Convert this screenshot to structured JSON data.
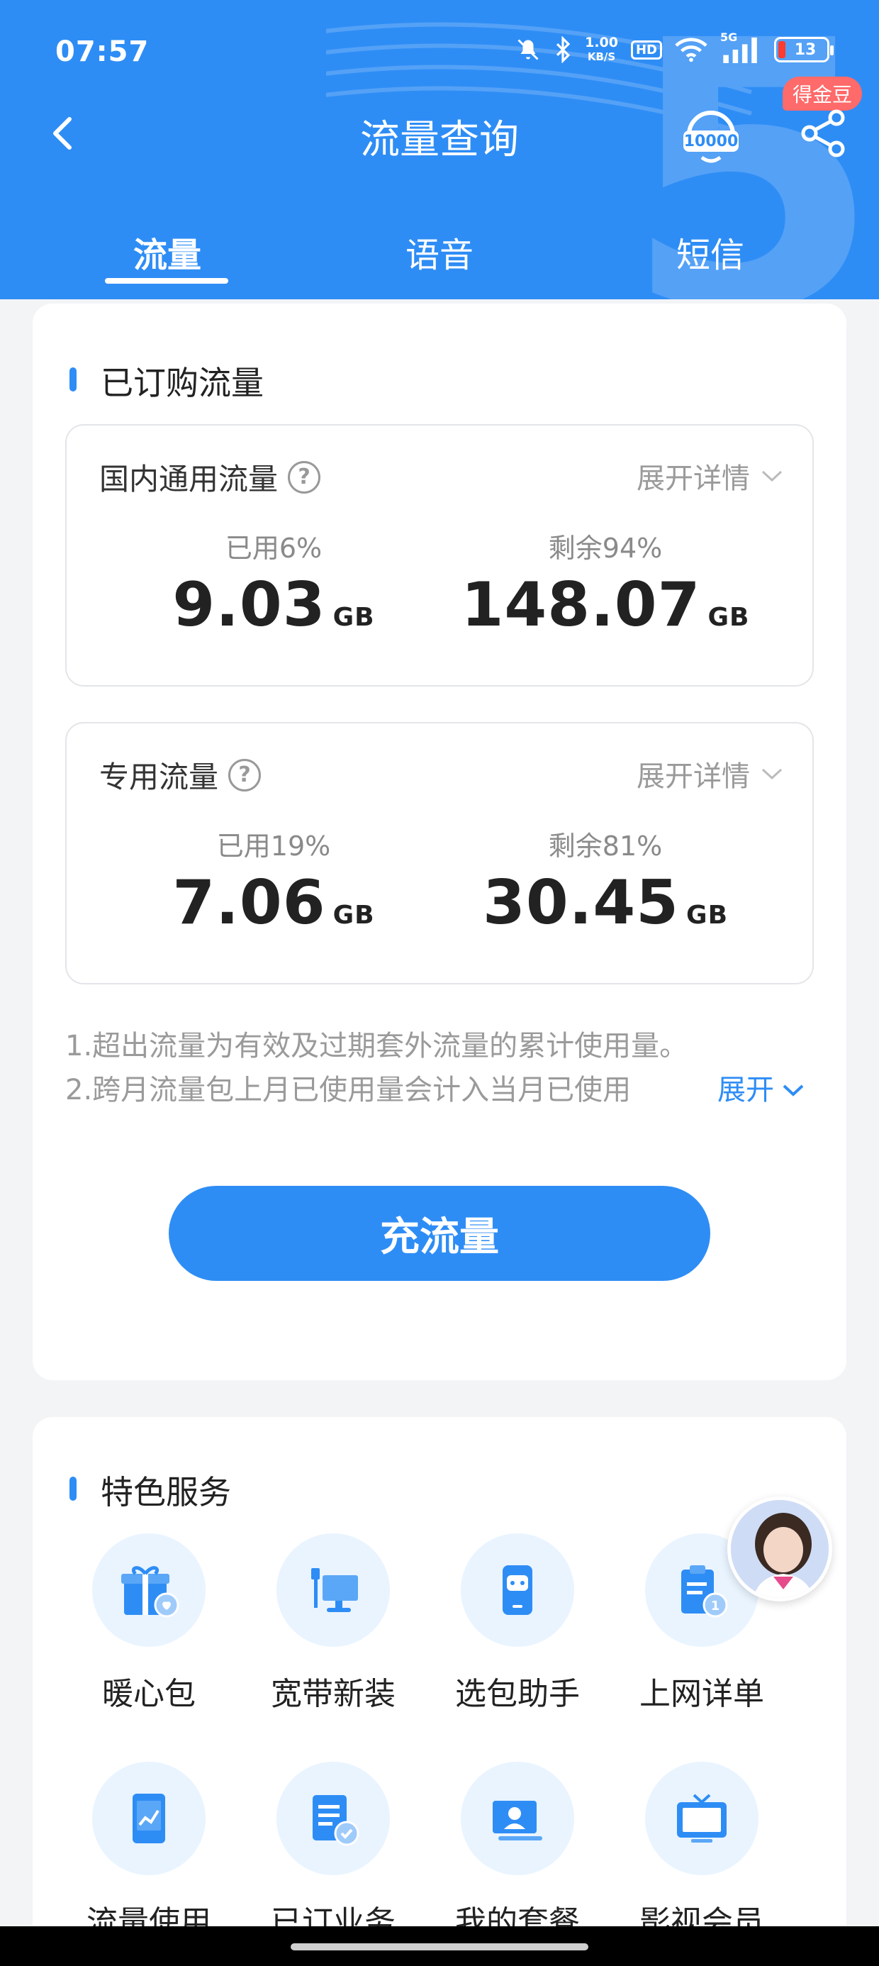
{
  "status_bar": {
    "time": "07:57",
    "speed_value": "1.00",
    "speed_unit": "KB/S",
    "hd": "HD",
    "network": "5G",
    "battery": "13"
  },
  "header": {
    "title": "流量查询",
    "coin_badge": "得金豆",
    "tabs": [
      "流量",
      "语音",
      "短信"
    ],
    "active_tab": "流量",
    "colors": {
      "brand": "#2e8df5",
      "badge": "#ff6a6a"
    }
  },
  "subscribed": {
    "section_title": "已订购流量",
    "boxes": [
      {
        "name": "国内通用流量",
        "expand_label": "展开详情",
        "used_pct": "已用6%",
        "used_value": "9.03",
        "used_unit": "GB",
        "remain_pct": "剩余94%",
        "remain_value": "148.07",
        "remain_unit": "GB"
      },
      {
        "name": "专用流量",
        "expand_label": "展开详情",
        "used_pct": "已用19%",
        "used_value": "7.06",
        "used_unit": "GB",
        "remain_pct": "剩余81%",
        "remain_value": "30.45",
        "remain_unit": "GB"
      }
    ],
    "notes": [
      "1.超出流量为有效及过期套外流量的累计使用量。",
      "2.跨月流量包上月已使用量会计入当月已使用"
    ],
    "notes_more": "展开",
    "recharge_button": "充流量"
  },
  "services": {
    "section_title": "特色服务",
    "items": [
      {
        "label": "暖心包",
        "icon": "gift-heart-icon"
      },
      {
        "label": "宽带新装",
        "icon": "broadband-icon"
      },
      {
        "label": "选包助手",
        "icon": "robot-phone-icon"
      },
      {
        "label": "上网详单",
        "icon": "clipboard-icon"
      },
      {
        "label": "流量使用",
        "icon": "phone-chart-icon"
      },
      {
        "label": "已订业务",
        "icon": "document-check-icon"
      },
      {
        "label": "我的套餐",
        "icon": "profile-card-icon"
      },
      {
        "label": "影视会员",
        "icon": "tv-icon"
      }
    ]
  }
}
